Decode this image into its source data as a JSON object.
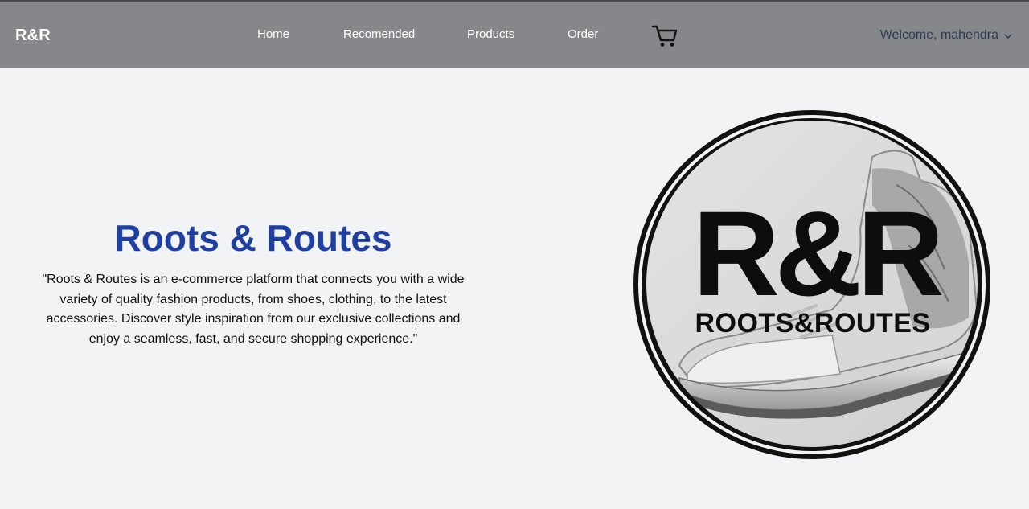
{
  "header": {
    "brand": "R&R",
    "nav": {
      "home": "Home",
      "recommended": "Recomended",
      "products": "Products",
      "order": "Order"
    },
    "cart_icon": "cart-icon",
    "welcome": "Welcome, mahendra"
  },
  "hero": {
    "title": "Roots & Routes",
    "description": "\"Roots & Routes is an e-commerce platform that connects you with a wide variety of quality fashion products, from shoes, clothing, to the latest accessories. Discover style inspiration from our exclusive collections and enjoy a seamless, fast, and secure shopping experience.\""
  },
  "logo": {
    "monogram": "R&R",
    "wordmark": "ROOTS&ROUTES"
  },
  "colors": {
    "header_bg": "#85878a",
    "page_bg": "#f2f3f5",
    "title": "#1f3fa3",
    "welcome": "#2e3a4f"
  }
}
